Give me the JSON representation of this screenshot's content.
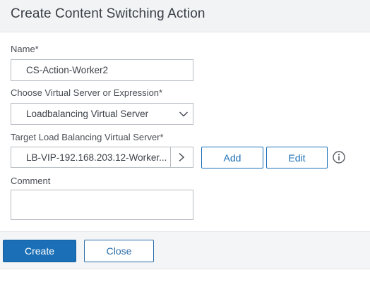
{
  "dialog": {
    "title": "Create Content Switching Action"
  },
  "form": {
    "name": {
      "label": "Name*",
      "value": "CS-Action-Worker2"
    },
    "choose": {
      "label": "Choose Virtual Server or Expression*",
      "selected": "Loadbalancing Virtual Server"
    },
    "target": {
      "label": "Target Load Balancing Virtual Server*",
      "value": "LB-VIP-192.168.203.12-Worker...",
      "add_label": "Add",
      "edit_label": "Edit"
    },
    "comment": {
      "label": "Comment",
      "value": ""
    }
  },
  "footer": {
    "create_label": "Create",
    "close_label": "Close"
  },
  "icons": {
    "dropdown": "chevron-down-icon",
    "browse": "chevron-right-icon",
    "info": "info-icon"
  },
  "colors": {
    "accent": "#1a6fb7",
    "header_bg": "#f1f3f5"
  }
}
